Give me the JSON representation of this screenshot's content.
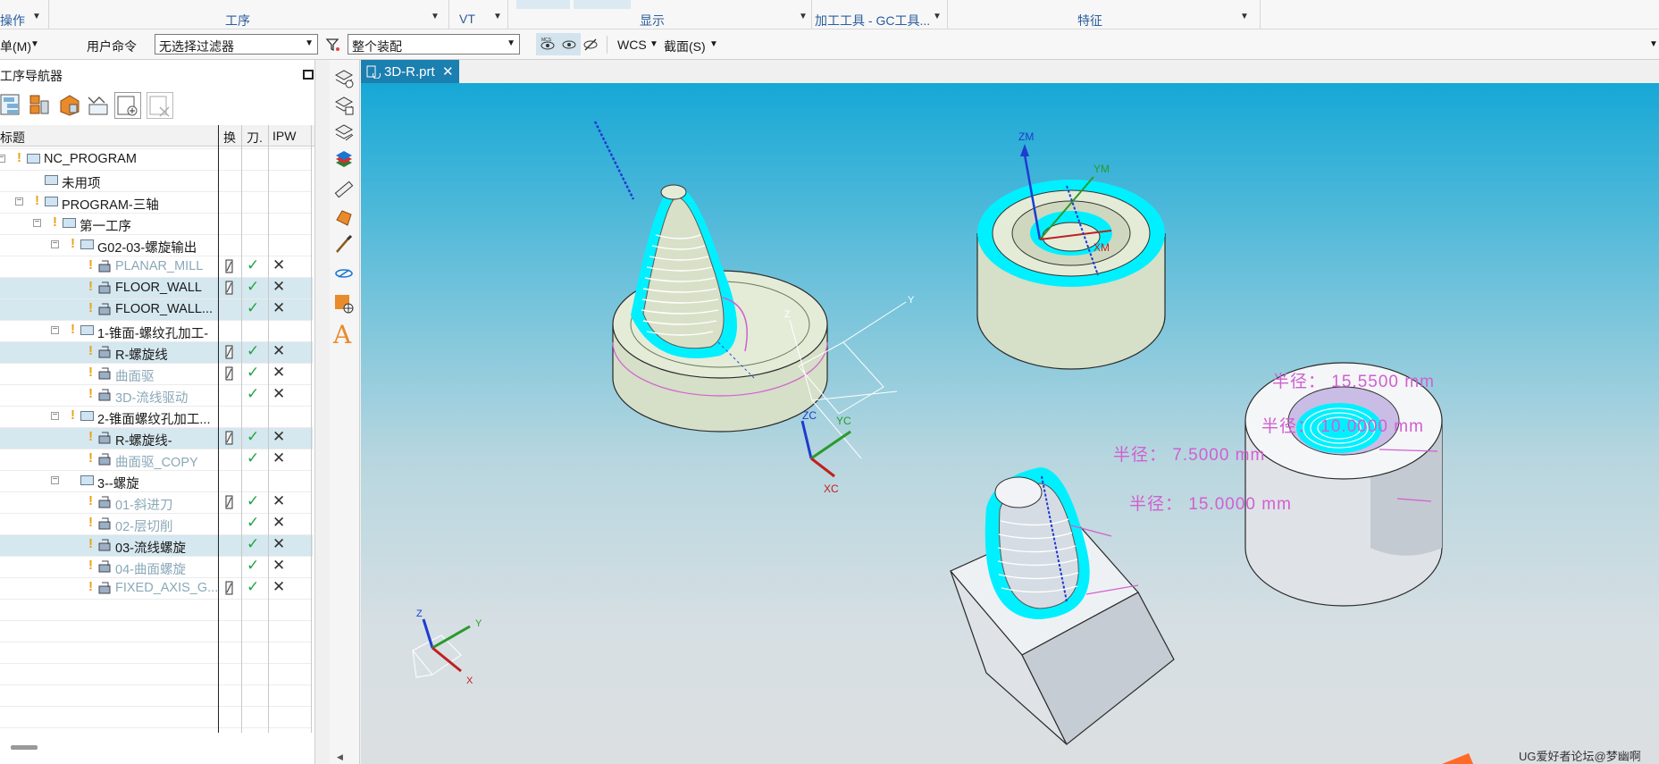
{
  "ribbon": {
    "groups": [
      {
        "label": "操作"
      },
      {
        "label": "工序"
      },
      {
        "label": "VT"
      },
      {
        "label": "显示"
      },
      {
        "label": "加工工具 - GC工具..."
      },
      {
        "label": "特征"
      }
    ]
  },
  "toolbar": {
    "menu_label": "单(M)",
    "user_command": "用户命令",
    "filter_value": "无选择过滤器",
    "assembly_value": "整个装配",
    "wcs_label": "WCS",
    "section_label": "截面(S)"
  },
  "navigator": {
    "title": "工序导航器",
    "columns": [
      "标题",
      "换",
      "刀.",
      "IPW"
    ],
    "rows": [
      {
        "label": "NC_PROGRAM",
        "level": 0,
        "kind": "program",
        "warn": true,
        "dim": false,
        "sel": false,
        "tool": false,
        "check": false,
        "ipw": false
      },
      {
        "label": "未用项",
        "level": 1,
        "kind": "folder",
        "warn": false,
        "dim": false,
        "sel": false,
        "tool": false,
        "check": false,
        "ipw": false
      },
      {
        "label": "PROGRAM-三轴",
        "level": 1,
        "kind": "program",
        "warn": true,
        "dim": false,
        "sel": false,
        "tool": false,
        "check": false,
        "ipw": false
      },
      {
        "label": "第一工序",
        "level": 2,
        "kind": "program",
        "warn": true,
        "dim": false,
        "sel": false,
        "tool": false,
        "check": false,
        "ipw": false
      },
      {
        "label": "G02-03-螺旋输出",
        "level": 3,
        "kind": "program",
        "warn": true,
        "dim": false,
        "sel": false,
        "tool": false,
        "check": false,
        "ipw": false
      },
      {
        "label": "PLANAR_MILL",
        "level": 4,
        "kind": "op",
        "warn": true,
        "dim": true,
        "sel": false,
        "tool": true,
        "check": true,
        "ipw": true
      },
      {
        "label": "FLOOR_WALL",
        "level": 4,
        "kind": "op",
        "warn": true,
        "dim": false,
        "sel": true,
        "tool": true,
        "check": true,
        "ipw": true
      },
      {
        "label": "FLOOR_WALL...",
        "level": 4,
        "kind": "op",
        "warn": true,
        "dim": false,
        "sel": true,
        "tool": false,
        "check": true,
        "ipw": true
      },
      {
        "label": "1-锥面-螺纹孔加工-",
        "level": 3,
        "kind": "program",
        "warn": true,
        "dim": false,
        "sel": false,
        "tool": false,
        "check": false,
        "ipw": false
      },
      {
        "label": "R-螺旋线",
        "level": 4,
        "kind": "op",
        "warn": true,
        "dim": false,
        "sel": true,
        "tool": true,
        "check": true,
        "ipw": true
      },
      {
        "label": "曲面驱",
        "level": 4,
        "kind": "op",
        "warn": true,
        "dim": true,
        "sel": false,
        "tool": true,
        "check": true,
        "ipw": true
      },
      {
        "label": "3D-流线驱动",
        "level": 4,
        "kind": "op",
        "warn": true,
        "dim": true,
        "sel": false,
        "tool": false,
        "check": true,
        "ipw": true
      },
      {
        "label": "2-锥面螺纹孔加工...",
        "level": 3,
        "kind": "program",
        "warn": true,
        "dim": false,
        "sel": false,
        "tool": false,
        "check": false,
        "ipw": false
      },
      {
        "label": "R-螺旋线-",
        "level": 4,
        "kind": "op",
        "warn": true,
        "dim": false,
        "sel": true,
        "tool": true,
        "check": true,
        "ipw": true
      },
      {
        "label": "曲面驱_COPY",
        "level": 4,
        "kind": "op",
        "warn": true,
        "dim": true,
        "sel": false,
        "tool": false,
        "check": true,
        "ipw": true
      },
      {
        "label": "3--螺旋",
        "level": 3,
        "kind": "program",
        "warn": false,
        "dim": false,
        "sel": false,
        "tool": false,
        "check": false,
        "ipw": false
      },
      {
        "label": "01-斜进刀",
        "level": 4,
        "kind": "op",
        "warn": true,
        "dim": true,
        "sel": false,
        "tool": true,
        "check": true,
        "ipw": true
      },
      {
        "label": "02-层切削",
        "level": 4,
        "kind": "op",
        "warn": true,
        "dim": true,
        "sel": false,
        "tool": false,
        "check": true,
        "ipw": true
      },
      {
        "label": "03-流线螺旋",
        "level": 4,
        "kind": "op",
        "warn": true,
        "dim": false,
        "sel": true,
        "tool": false,
        "check": true,
        "ipw": true
      },
      {
        "label": "04-曲面螺旋",
        "level": 4,
        "kind": "op",
        "warn": true,
        "dim": true,
        "sel": false,
        "tool": false,
        "check": true,
        "ipw": true
      },
      {
        "label": "FIXED_AXIS_G...",
        "level": 4,
        "kind": "op",
        "warn": true,
        "dim": true,
        "sel": false,
        "tool": true,
        "check": true,
        "ipw": true
      }
    ]
  },
  "viewport": {
    "tab_label": "3D-R.prt",
    "dimensions": [
      "半径： 15.5500 mm",
      "半径： 10.0000 mm",
      "半径： 7.5000 mm",
      "半径： 15.0000 mm"
    ],
    "wcs_labels": {
      "zc": "ZC",
      "yc": "YC",
      "xc": "XC",
      "z": "Z",
      "y": "Y"
    },
    "mcs_labels": {
      "zm": "ZM",
      "ym": "YM",
      "xm": "XM"
    },
    "triad_labels": {
      "z": "Z",
      "y": "Y",
      "x": "X"
    }
  },
  "watermark": "UG爱好者论坛@梦幽啊",
  "colors": {
    "accent": "#1b7fb0",
    "toolpath": "#00f0ff",
    "dimension": "#d060d0",
    "check": "#23a343",
    "warn": "#e8a317"
  }
}
